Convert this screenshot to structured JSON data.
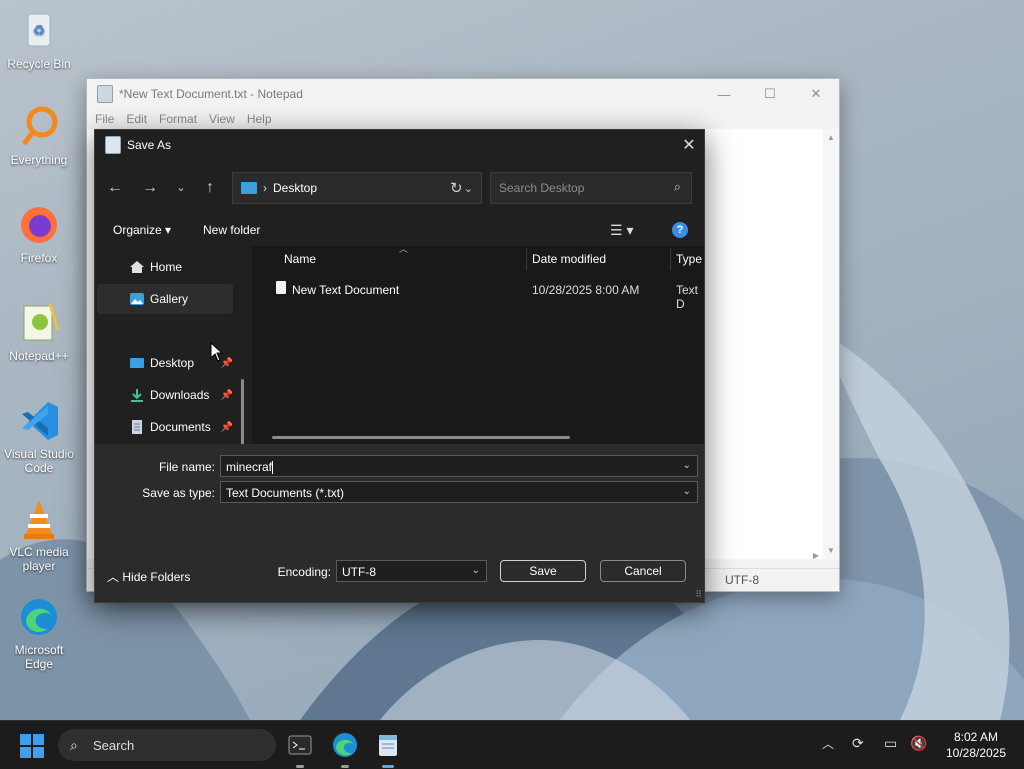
{
  "desktop": {
    "icons": [
      {
        "label": "Recycle Bin",
        "icon": "recycle-bin-icon"
      },
      {
        "label": "Everything",
        "icon": "everything-search-icon"
      },
      {
        "label": "Firefox",
        "icon": "firefox-icon"
      },
      {
        "label": "Notepad++",
        "icon": "notepad-plus-plus-icon"
      },
      {
        "label": "Visual Studio Code",
        "icon": "vscode-icon"
      },
      {
        "label": "VLC media player",
        "icon": "vlc-icon"
      },
      {
        "label": "Microsoft Edge",
        "icon": "edge-icon"
      }
    ]
  },
  "notepad": {
    "title": "*New Text Document.txt - Notepad",
    "menu": [
      "File",
      "Edit",
      "Format",
      "View",
      "Help"
    ],
    "status_encoding": "UTF-8"
  },
  "dialog": {
    "title": "Save As",
    "address": "Desktop",
    "search_placeholder": "Search Desktop",
    "toolbar": {
      "organize": "Organize",
      "new_folder": "New folder"
    },
    "nav": [
      {
        "label": "Home",
        "icon": "home-icon",
        "pinned": false
      },
      {
        "label": "Gallery",
        "icon": "gallery-icon",
        "pinned": false,
        "selected": true
      },
      {
        "label": "Desktop",
        "icon": "desktop-folder-icon",
        "pinned": true
      },
      {
        "label": "Downloads",
        "icon": "downloads-icon",
        "pinned": true
      },
      {
        "label": "Documents",
        "icon": "documents-icon",
        "pinned": true
      }
    ],
    "columns": {
      "name": "Name",
      "date": "Date modified",
      "type": "Type"
    },
    "files": [
      {
        "name": "New Text Document",
        "date": "10/28/2025 8:00 AM",
        "type": "Text D"
      }
    ],
    "file_name_label": "File name:",
    "file_name_value": "minecraf",
    "save_type_label": "Save as type:",
    "save_type_value": "Text Documents (*.txt)",
    "encoding_label": "Encoding:",
    "encoding_value": "UTF-8",
    "save_button": "Save",
    "cancel_button": "Cancel",
    "hide_folders": "Hide Folders"
  },
  "taskbar": {
    "search_label": "Search",
    "time": "8:02 AM",
    "date": "10/28/2025"
  },
  "colors": {
    "dialog_bg": "#202020",
    "accent": "#3a8ee6",
    "taskbar_bg": "#1c1c1c"
  }
}
